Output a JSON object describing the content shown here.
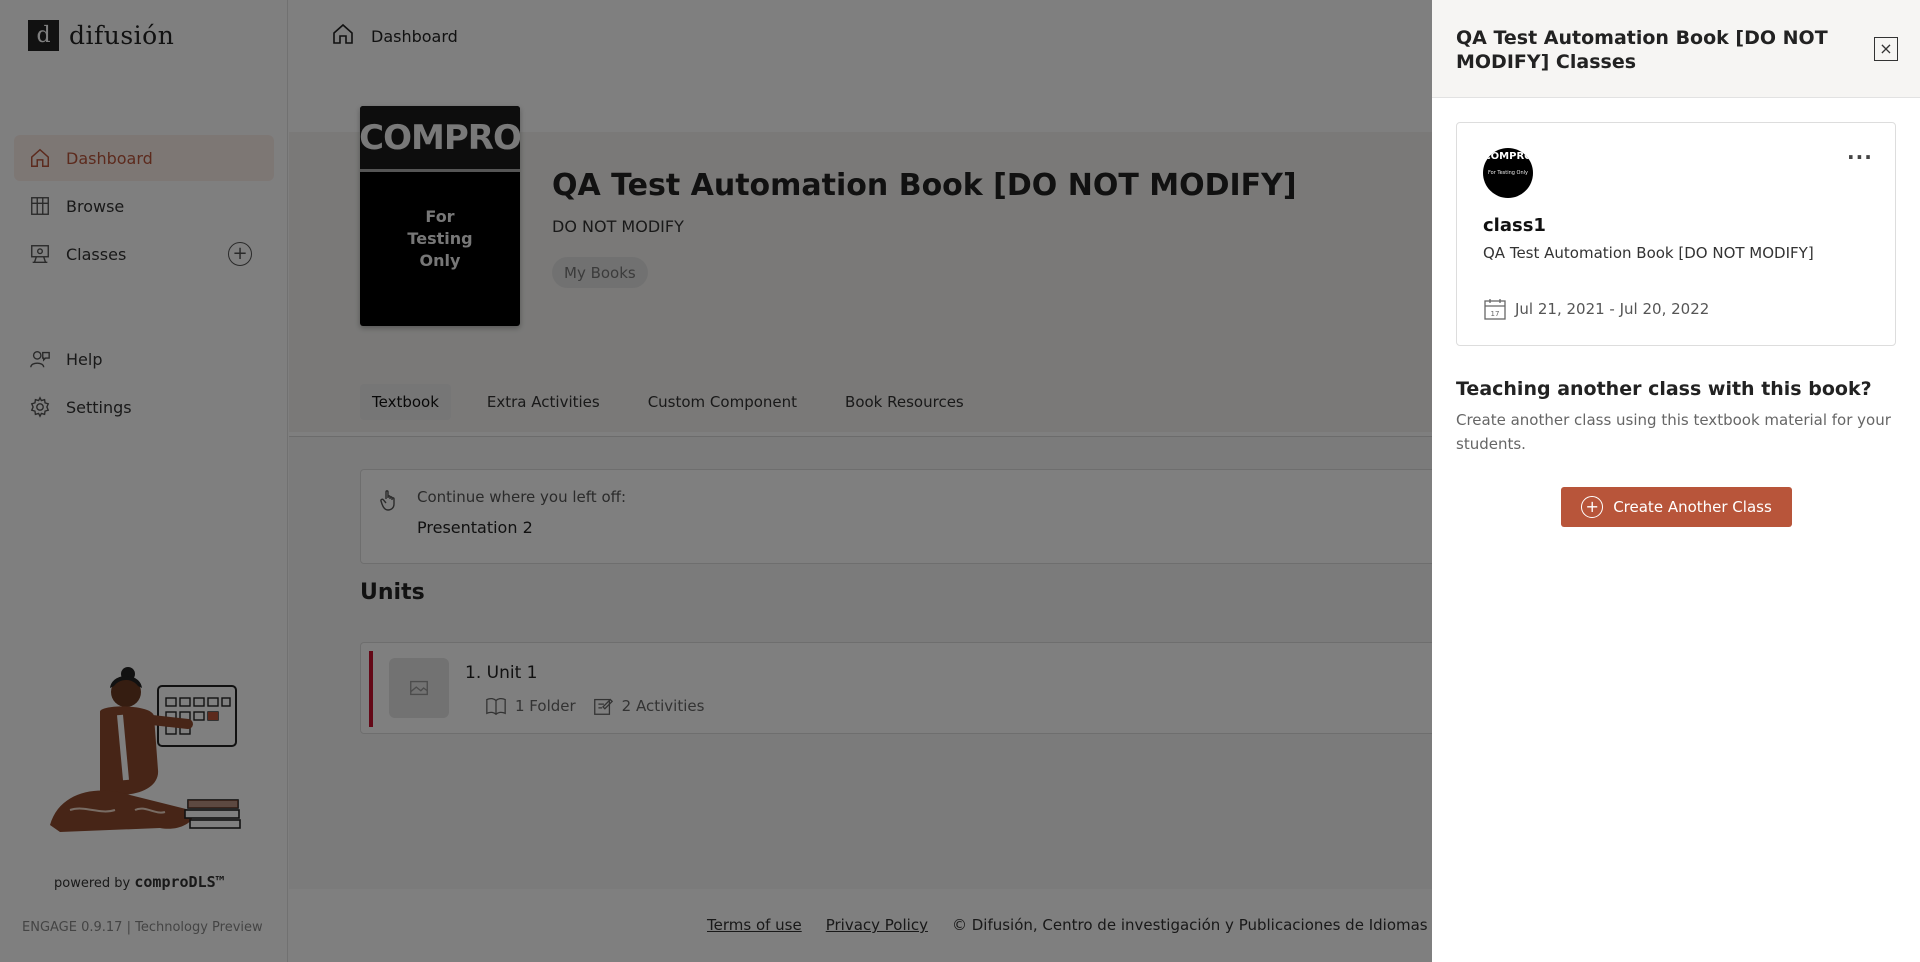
{
  "sidebar": {
    "logo_text": "difusión",
    "logo_mark": "d",
    "items": [
      {
        "label": "Dashboard",
        "icon": "home-icon",
        "active": true
      },
      {
        "label": "Browse",
        "icon": "library-icon"
      },
      {
        "label": "Classes",
        "icon": "classes-icon"
      }
    ],
    "items2": [
      {
        "label": "Help",
        "icon": "help-icon"
      },
      {
        "label": "Settings",
        "icon": "gear-icon"
      }
    ],
    "powered_prefix": "powered by",
    "powered_brand": "comproDLS™",
    "version": "ENGAGE 0.9.17 | Technology Preview"
  },
  "topbar": {
    "breadcrumb": "Dashboard"
  },
  "book": {
    "cover_top": "COMPRO",
    "cover_line1": "For",
    "cover_line2": "Testing",
    "cover_line3": "Only",
    "title": "QA Test Automation Book [DO NOT MODIFY]",
    "subtitle": "DO NOT MODIFY",
    "tag": "My Books"
  },
  "tabs": [
    {
      "label": "Textbook",
      "active": true
    },
    {
      "label": "Extra Activities"
    },
    {
      "label": "Custom Component"
    },
    {
      "label": "Book Resources"
    }
  ],
  "continue": {
    "label": "Continue where you left off:",
    "value": "Presentation 2"
  },
  "units": {
    "heading": "Units",
    "items": [
      {
        "number": "1.",
        "title": "Unit 1",
        "folders": "1 Folder",
        "activities": "2 Activities"
      }
    ]
  },
  "footer": {
    "terms": "Terms of use",
    "privacy": "Privacy Policy",
    "copyright": "© Difusión, Centro de investigación y Publicaciones de Idiomas"
  },
  "drawer": {
    "title": "QA Test Automation Book [DO NOT MODIFY] Classes",
    "close": "×",
    "class_card": {
      "avatar_top": "COMPRO",
      "avatar_sub": "For Testing Only",
      "more": "···",
      "name": "class1",
      "book": "QA Test Automation Book [DO NOT MODIFY]",
      "dates": "Jul 21, 2021 - Jul 20, 2022"
    },
    "teach_heading": "Teaching another class with this book?",
    "teach_text": "Create another class using this textbook material for your students.",
    "create_button": "Create Another Class"
  },
  "colors": {
    "accent": "#b8553a",
    "unit_bar": "#c8102e",
    "overlay": "rgba(0,0,0,0.5)"
  }
}
